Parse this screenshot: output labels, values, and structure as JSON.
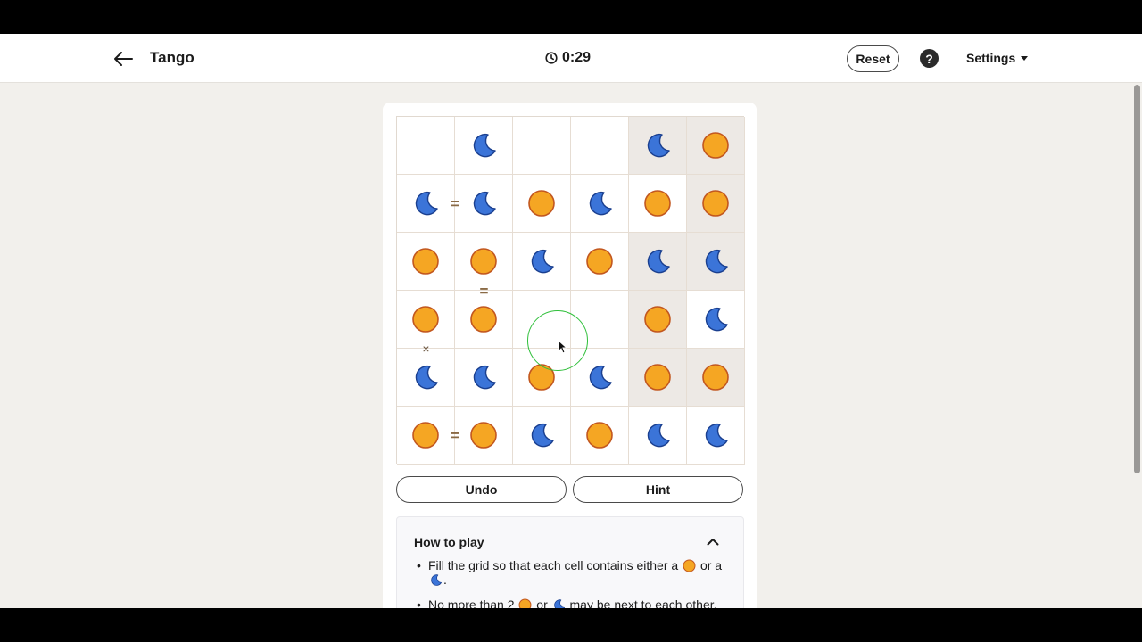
{
  "header": {
    "back_icon": "arrow-left-icon",
    "title": "Tango",
    "timer_icon": "clock-icon",
    "timer": "0:29",
    "reset_label": "Reset",
    "help_label": "?",
    "settings_label": "Settings"
  },
  "board": {
    "size": 6,
    "cells": [
      [
        "empty",
        "moon",
        "empty",
        "empty",
        "moon",
        "sun"
      ],
      [
        "moon",
        "moon",
        "sun",
        "moon",
        "sun",
        "sun"
      ],
      [
        "sun",
        "sun",
        "moon",
        "sun",
        "moon",
        "moon"
      ],
      [
        "sun",
        "sun",
        "empty",
        "empty",
        "sun",
        "moon"
      ],
      [
        "moon",
        "moon",
        "sun",
        "moon",
        "sun",
        "sun"
      ],
      [
        "sun",
        "sun",
        "moon",
        "sun",
        "moon",
        "moon"
      ]
    ],
    "locked": [
      [
        0,
        4
      ],
      [
        0,
        5
      ],
      [
        1,
        5
      ],
      [
        2,
        4
      ],
      [
        2,
        5
      ],
      [
        3,
        4
      ],
      [
        4,
        4
      ],
      [
        4,
        5
      ]
    ],
    "constraints": [
      {
        "between": [
          [
            1,
            0
          ],
          [
            1,
            1
          ]
        ],
        "symbol": "="
      },
      {
        "between": [
          [
            2,
            1
          ],
          [
            3,
            1
          ]
        ],
        "symbol": "="
      },
      {
        "between": [
          [
            3,
            0
          ],
          [
            4,
            0
          ]
        ],
        "symbol": "×"
      },
      {
        "between": [
          [
            5,
            0
          ],
          [
            5,
            1
          ]
        ],
        "symbol": "="
      }
    ]
  },
  "controls": {
    "undo_label": "Undo",
    "hint_label": "Hint"
  },
  "how_to_play": {
    "title": "How to play",
    "toggle_icon": "chevron-up-icon",
    "rule1_a": "Fill the grid so that each cell contains either a",
    "rule1_b": "or a",
    "rule1_c": ".",
    "rule2_a": "No more than 2",
    "rule2_b": "or",
    "rule2_c": "may be next to each other."
  },
  "colors": {
    "sun_fill": "#f5a623",
    "sun_stroke": "#c2571f",
    "moon_fill": "#3b74d8",
    "moon_stroke": "#1a3f8f",
    "locked_bg": "#ede9e5",
    "constraint": "#8a6a45"
  }
}
